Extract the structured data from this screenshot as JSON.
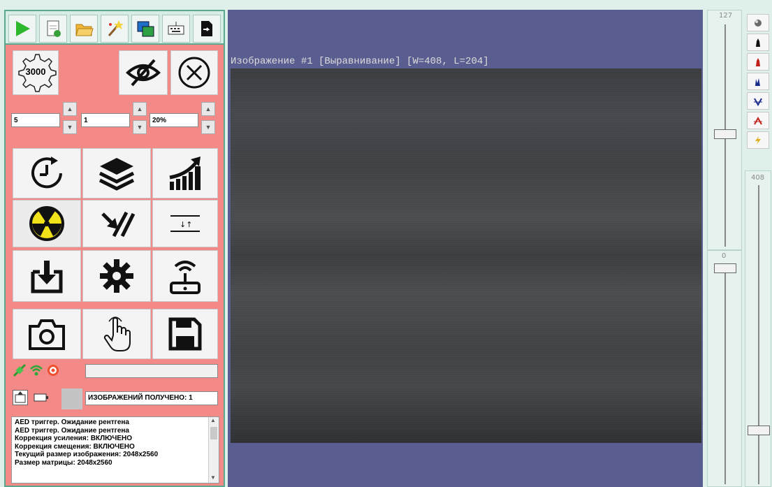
{
  "toolbar": {
    "icons": [
      "play-icon",
      "new-document-icon",
      "open-folder-icon",
      "magic-wand-icon",
      "windows-icon",
      "keyboard-icon",
      "export-icon"
    ]
  },
  "panel": {
    "gear_label": "3000",
    "spin1_value": "5",
    "spin2_value": "1",
    "spin3_value": "20%",
    "status_field": "",
    "images_received": "ИЗОБРАЖЕНИЙ ПОЛУЧЕНО: 1"
  },
  "log": {
    "lines": [
      "AED триггер. Ожидание рентгена",
      "AED триггер. Ожидание рентгена",
      "Коррекция усиления: ВКЛЮЧЕНО",
      "Коррекция смещения: ВКЛЮЧЕНО",
      "Текущий размер изображения: 2048x2560",
      "Размер матрицы: 2048x2560"
    ]
  },
  "viewer": {
    "title": "Изображение #1 [Выравнивание] [W=408, L=204]"
  },
  "sliders": {
    "top_value": "127",
    "middle_value": "0",
    "right_value": "408"
  },
  "colors": {
    "panel": "#f38a87",
    "viewer_bg": "#5a5d8f",
    "frame": "#5aa88d"
  }
}
